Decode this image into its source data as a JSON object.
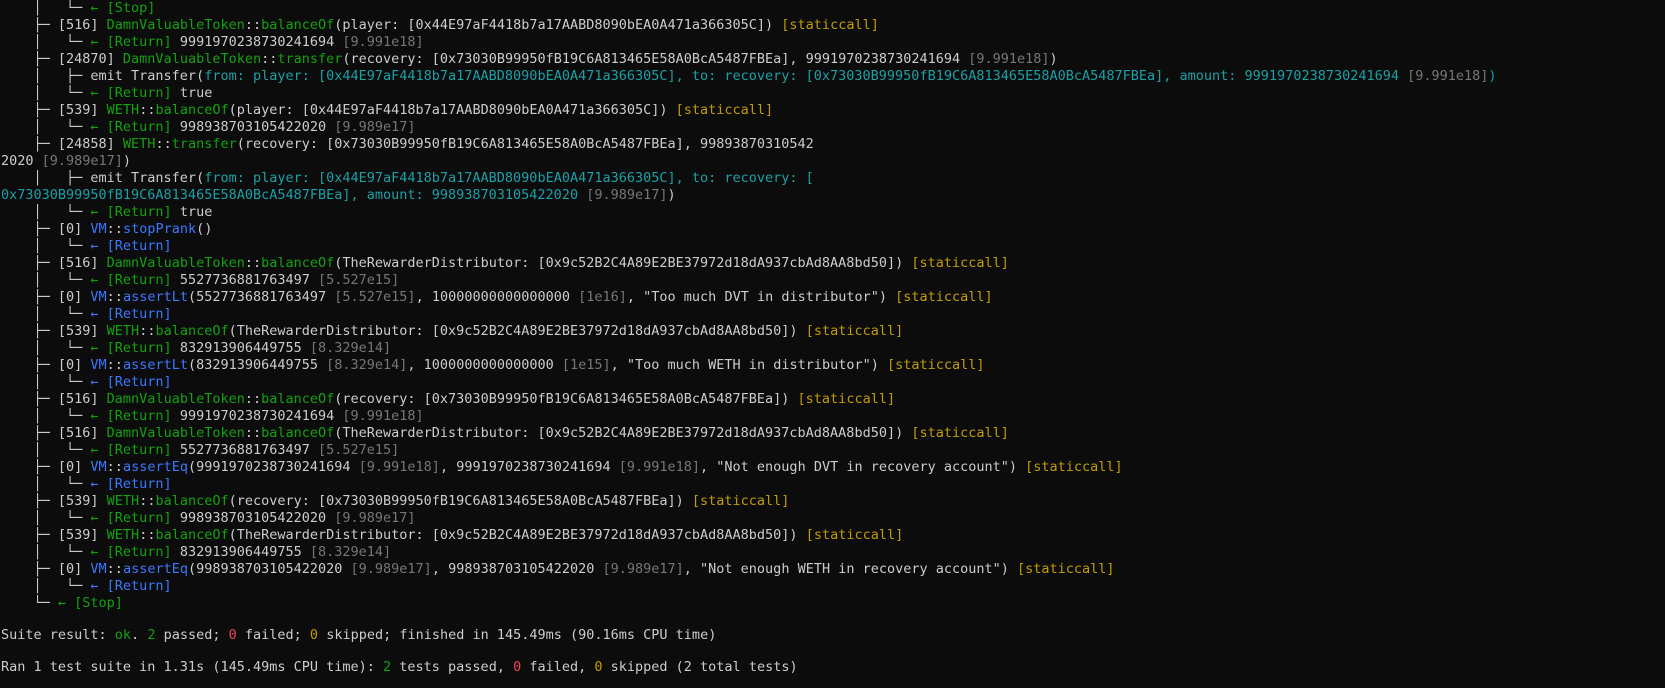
{
  "palette": {
    "background": "#0c0c0c",
    "default": "#cccccc",
    "green": "#13a10e",
    "blue": "#3b78ff",
    "yellow": "#c19c00",
    "red": "#e74856",
    "cyan": "#3a96dd",
    "teal": "#1ba0a6",
    "dim": "#767676"
  },
  "trace": [
    [
      [
        "w",
        "    │   └─ "
      ],
      [
        "g",
        "← [Stop]"
      ]
    ],
    [
      [
        "w",
        "    ├─ [516] "
      ],
      [
        "g",
        "DamnValuableToken"
      ],
      [
        "w",
        "::"
      ],
      [
        "g",
        "balanceOf"
      ],
      [
        "w",
        "(player: [0x44E97aF4418b7a17AABD8090bEA0A471a366305C]) "
      ],
      [
        "y",
        "[staticcall]"
      ]
    ],
    [
      [
        "w",
        "    │   └─ "
      ],
      [
        "g",
        "← [Return] "
      ],
      [
        "w",
        "9991970238730241694 "
      ],
      [
        "d",
        "[9.991e18]"
      ]
    ],
    [
      [
        "w",
        "    ├─ [24870] "
      ],
      [
        "g",
        "DamnValuableToken"
      ],
      [
        "w",
        "::"
      ],
      [
        "g",
        "transfer"
      ],
      [
        "w",
        "(recovery: [0x73030B99950fB19C6A813465E58A0BcA5487FBEa], 9991970238730241694 "
      ],
      [
        "d",
        "[9.991e18]"
      ],
      [
        "w",
        ")"
      ]
    ],
    [
      [
        "w",
        "    │   ├─ emit Transfer("
      ],
      [
        "t",
        "from: player: [0x44E97aF4418b7a17AABD8090bEA0A471a366305C], to: recovery: [0x73030B99950fB19C6A813465E58A0BcA5487FBEa], amount: 9991970238730241694 "
      ],
      [
        "d",
        "[9.991e18]"
      ],
      [
        "t",
        ")"
      ]
    ],
    [
      [
        "w",
        "    │   └─ "
      ],
      [
        "g",
        "← [Return] "
      ],
      [
        "w",
        "true"
      ]
    ],
    [
      [
        "w",
        "    ├─ [539] "
      ],
      [
        "g",
        "WETH"
      ],
      [
        "w",
        "::"
      ],
      [
        "g",
        "balanceOf"
      ],
      [
        "w",
        "(player: [0x44E97aF4418b7a17AABD8090bEA0A471a366305C]) "
      ],
      [
        "y",
        "[staticcall]"
      ]
    ],
    [
      [
        "w",
        "    │   └─ "
      ],
      [
        "g",
        "← [Return] "
      ],
      [
        "w",
        "998938703105422020 "
      ],
      [
        "d",
        "[9.989e17]"
      ]
    ],
    [
      [
        "w",
        "    ├─ [24858] "
      ],
      [
        "g",
        "WETH"
      ],
      [
        "w",
        "::"
      ],
      [
        "g",
        "transfer"
      ],
      [
        "w",
        "(recovery: [0x73030B99950fB19C6A813465E58A0BcA5487FBEa], 99893870310542"
      ]
    ],
    [
      [
        "w",
        "2020 "
      ],
      [
        "d",
        "[9.989e17]"
      ],
      [
        "w",
        ")"
      ]
    ],
    [
      [
        "w",
        "    │   ├─ emit Transfer("
      ],
      [
        "t",
        "from: player: [0x44E97aF4418b7a17AABD8090bEA0A471a366305C], to: recovery: ["
      ]
    ],
    [
      [
        "t",
        "0x73030B99950fB19C6A813465E58A0BcA5487FBEa], amount: 998938703105422020 "
      ],
      [
        "d",
        "[9.989e17]"
      ],
      [
        "w",
        ")"
      ]
    ],
    [
      [
        "w",
        "    │   └─ "
      ],
      [
        "g",
        "← [Return] "
      ],
      [
        "w",
        "true"
      ]
    ],
    [
      [
        "w",
        "    ├─ [0] "
      ],
      [
        "b",
        "VM"
      ],
      [
        "w",
        "::"
      ],
      [
        "b",
        "stopPrank"
      ],
      [
        "w",
        "()"
      ]
    ],
    [
      [
        "w",
        "    │   └─ "
      ],
      [
        "b",
        "← [Return]"
      ]
    ],
    [
      [
        "w",
        "    ├─ [516] "
      ],
      [
        "g",
        "DamnValuableToken"
      ],
      [
        "w",
        "::"
      ],
      [
        "g",
        "balanceOf"
      ],
      [
        "w",
        "(TheRewarderDistributor: [0x9c52B2C4A89E2BE37972d18dA937cbAd8AA8bd50]) "
      ],
      [
        "y",
        "[staticcall]"
      ]
    ],
    [
      [
        "w",
        "    │   └─ "
      ],
      [
        "g",
        "← [Return] "
      ],
      [
        "w",
        "5527736881763497 "
      ],
      [
        "d",
        "[5.527e15]"
      ]
    ],
    [
      [
        "w",
        "    ├─ [0] "
      ],
      [
        "b",
        "VM"
      ],
      [
        "w",
        "::"
      ],
      [
        "b",
        "assertLt"
      ],
      [
        "w",
        "(5527736881763497 "
      ],
      [
        "d",
        "[5.527e15]"
      ],
      [
        "w",
        ", 10000000000000000 "
      ],
      [
        "d",
        "[1e16]"
      ],
      [
        "w",
        ", \"Too much DVT in distributor\") "
      ],
      [
        "y",
        "[staticcall]"
      ]
    ],
    [
      [
        "w",
        "    │   └─ "
      ],
      [
        "b",
        "← [Return]"
      ]
    ],
    [
      [
        "w",
        "    ├─ [539] "
      ],
      [
        "g",
        "WETH"
      ],
      [
        "w",
        "::"
      ],
      [
        "g",
        "balanceOf"
      ],
      [
        "w",
        "(TheRewarderDistributor: [0x9c52B2C4A89E2BE37972d18dA937cbAd8AA8bd50]) "
      ],
      [
        "y",
        "[staticcall]"
      ]
    ],
    [
      [
        "w",
        "    │   └─ "
      ],
      [
        "g",
        "← [Return] "
      ],
      [
        "w",
        "832913906449755 "
      ],
      [
        "d",
        "[8.329e14]"
      ]
    ],
    [
      [
        "w",
        "    ├─ [0] "
      ],
      [
        "b",
        "VM"
      ],
      [
        "w",
        "::"
      ],
      [
        "b",
        "assertLt"
      ],
      [
        "w",
        "(832913906449755 "
      ],
      [
        "d",
        "[8.329e14]"
      ],
      [
        "w",
        ", 1000000000000000 "
      ],
      [
        "d",
        "[1e15]"
      ],
      [
        "w",
        ", \"Too much WETH in distributor\") "
      ],
      [
        "y",
        "[staticcall]"
      ]
    ],
    [
      [
        "w",
        "    │   └─ "
      ],
      [
        "b",
        "← [Return]"
      ]
    ],
    [
      [
        "w",
        "    ├─ [516] "
      ],
      [
        "g",
        "DamnValuableToken"
      ],
      [
        "w",
        "::"
      ],
      [
        "g",
        "balanceOf"
      ],
      [
        "w",
        "(recovery: [0x73030B99950fB19C6A813465E58A0BcA5487FBEa]) "
      ],
      [
        "y",
        "[staticcall]"
      ]
    ],
    [
      [
        "w",
        "    │   └─ "
      ],
      [
        "g",
        "← [Return] "
      ],
      [
        "w",
        "9991970238730241694 "
      ],
      [
        "d",
        "[9.991e18]"
      ]
    ],
    [
      [
        "w",
        "    ├─ [516] "
      ],
      [
        "g",
        "DamnValuableToken"
      ],
      [
        "w",
        "::"
      ],
      [
        "g",
        "balanceOf"
      ],
      [
        "w",
        "(TheRewarderDistributor: [0x9c52B2C4A89E2BE37972d18dA937cbAd8AA8bd50]) "
      ],
      [
        "y",
        "[staticcall]"
      ]
    ],
    [
      [
        "w",
        "    │   └─ "
      ],
      [
        "g",
        "← [Return] "
      ],
      [
        "w",
        "5527736881763497 "
      ],
      [
        "d",
        "[5.527e15]"
      ]
    ],
    [
      [
        "w",
        "    ├─ [0] "
      ],
      [
        "b",
        "VM"
      ],
      [
        "w",
        "::"
      ],
      [
        "b",
        "assertEq"
      ],
      [
        "w",
        "(9991970238730241694 "
      ],
      [
        "d",
        "[9.991e18]"
      ],
      [
        "w",
        ", 9991970238730241694 "
      ],
      [
        "d",
        "[9.991e18]"
      ],
      [
        "w",
        ", \"Not enough DVT in recovery account\") "
      ],
      [
        "y",
        "[staticcall]"
      ]
    ],
    [
      [
        "w",
        "    │   └─ "
      ],
      [
        "b",
        "← [Return]"
      ]
    ],
    [
      [
        "w",
        "    ├─ [539] "
      ],
      [
        "g",
        "WETH"
      ],
      [
        "w",
        "::"
      ],
      [
        "g",
        "balanceOf"
      ],
      [
        "w",
        "(recovery: [0x73030B99950fB19C6A813465E58A0BcA5487FBEa]) "
      ],
      [
        "y",
        "[staticcall]"
      ]
    ],
    [
      [
        "w",
        "    │   └─ "
      ],
      [
        "g",
        "← [Return] "
      ],
      [
        "w",
        "998938703105422020 "
      ],
      [
        "d",
        "[9.989e17]"
      ]
    ],
    [
      [
        "w",
        "    ├─ [539] "
      ],
      [
        "g",
        "WETH"
      ],
      [
        "w",
        "::"
      ],
      [
        "g",
        "balanceOf"
      ],
      [
        "w",
        "(TheRewarderDistributor: [0x9c52B2C4A89E2BE37972d18dA937cbAd8AA8bd50]) "
      ],
      [
        "y",
        "[staticcall]"
      ]
    ],
    [
      [
        "w",
        "    │   └─ "
      ],
      [
        "g",
        "← [Return] "
      ],
      [
        "w",
        "832913906449755 "
      ],
      [
        "d",
        "[8.329e14]"
      ]
    ],
    [
      [
        "w",
        "    ├─ [0] "
      ],
      [
        "b",
        "VM"
      ],
      [
        "w",
        "::"
      ],
      [
        "b",
        "assertEq"
      ],
      [
        "w",
        "(998938703105422020 "
      ],
      [
        "d",
        "[9.989e17]"
      ],
      [
        "w",
        ", 998938703105422020 "
      ],
      [
        "d",
        "[9.989e17]"
      ],
      [
        "w",
        ", \"Not enough WETH in recovery account\") "
      ],
      [
        "y",
        "[staticcall]"
      ]
    ],
    [
      [
        "w",
        "    │   └─ "
      ],
      [
        "b",
        "← [Return]"
      ]
    ],
    [
      [
        "w",
        "    └─ "
      ],
      [
        "g",
        "← [Stop]"
      ]
    ]
  ],
  "summary": [
    [
      [
        "w",
        "Suite result: "
      ],
      [
        "g",
        "ok"
      ],
      [
        "w",
        ". "
      ],
      [
        "g",
        "2"
      ],
      [
        "w",
        " passed; "
      ],
      [
        "r",
        "0"
      ],
      [
        "w",
        " failed; "
      ],
      [
        "y",
        "0"
      ],
      [
        "w",
        " skipped; finished in 145.49ms (90.16ms CPU time)"
      ]
    ],
    [
      [
        "w",
        "Ran 1 test suite in 1.31s (145.49ms CPU time): "
      ],
      [
        "g",
        "2"
      ],
      [
        "w",
        " tests passed, "
      ],
      [
        "r",
        "0"
      ],
      [
        "w",
        " failed, "
      ],
      [
        "y",
        "0"
      ],
      [
        "w",
        " skipped (2 total tests)"
      ]
    ]
  ]
}
